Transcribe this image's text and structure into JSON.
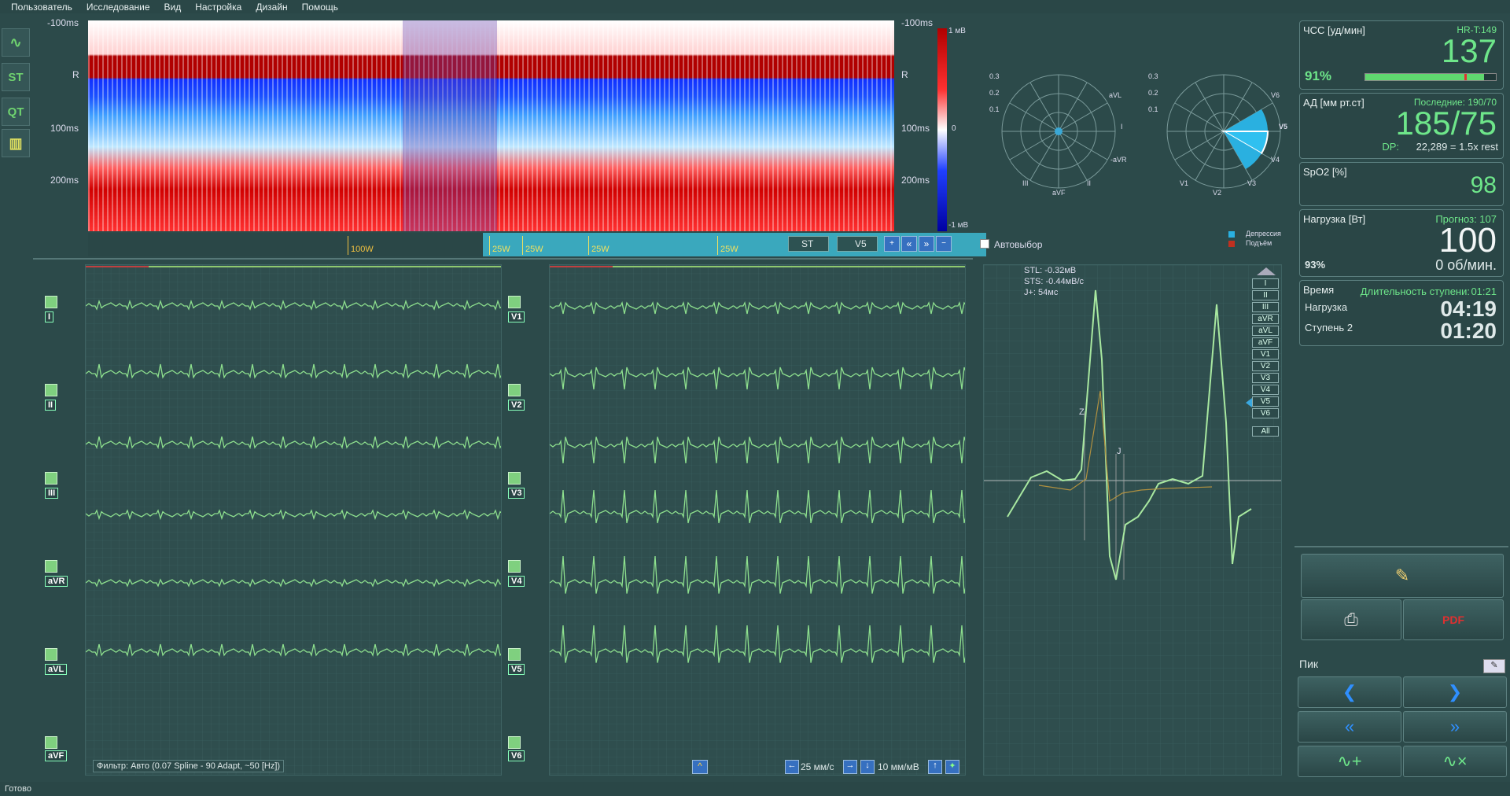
{
  "menu": [
    "Пользователь",
    "Исследование",
    "Вид",
    "Настройка",
    "Дизайн",
    "Помощь"
  ],
  "status": "Готово",
  "trend": {
    "y_ticks_left": [
      "-100ms",
      "R",
      "100ms",
      "200ms"
    ],
    "y_ticks_right": [
      "-100ms",
      "R",
      "100ms",
      "200ms"
    ],
    "colorbar": [
      "1 мВ",
      "0",
      "-1 мВ"
    ],
    "load_markers": [
      "100W",
      "25W",
      "25W",
      "25W",
      "25W"
    ],
    "lead_select": "ST",
    "lead_select2": "V5"
  },
  "polar": {
    "left_ticks": [
      "0.3",
      "0.2",
      "0.1"
    ],
    "left_labels": [
      "aVL",
      "I",
      "-aVR",
      "II",
      "aVF",
      "III"
    ],
    "right_ticks": [
      "0.3",
      "0.2",
      "0.1"
    ],
    "right_labels": [
      "V6",
      "V5",
      "V4",
      "V3",
      "V2",
      "V1"
    ],
    "autoselect": "Автовыбор",
    "legend": [
      "Депрессия",
      "Подъём"
    ]
  },
  "leads_left": [
    "I",
    "II",
    "III",
    "aVR",
    "aVL",
    "aVF"
  ],
  "leads_right": [
    "V1",
    "V2",
    "V3",
    "V4",
    "V5",
    "V6"
  ],
  "filter": "Фильтр: Авто (0.07 Spline - 90 Adapt, ~50 [Hz])",
  "speed": "25 мм/с",
  "gain": "10 мм/мВ",
  "complex": {
    "stl": "STL: -0.32мВ",
    "sts": "STS: -0.44мВ/с",
    "j": "J+: 54мс",
    "z": "Z",
    "jl": "J",
    "lead_buttons": [
      "I",
      "II",
      "III",
      "aVR",
      "aVL",
      "aVF",
      "V1",
      "V2",
      "V3",
      "V4",
      "V5",
      "V6",
      "All"
    ]
  },
  "vitals": {
    "hr_label": "ЧСС [уд/мин]",
    "hr_t": "HR-T:149",
    "hr": "137",
    "hr_pct": "91%",
    "hr_pct_value": 0.91,
    "bp_label": "АД [мм рт.ст]",
    "bp_last": "Последние: 190/70",
    "bp": "185/75",
    "dp_label": "DP:",
    "dp": "22,289 = 1.5x rest",
    "spo2_label": "SpO2 [%]",
    "spo2": "98",
    "load_label": "Нагрузка [Вт]",
    "forecast": "Прогноз: 107",
    "load": "100",
    "load_pct": "93%",
    "rpm": "0 об/мин.",
    "time_label": "Время",
    "stage_dur_label": "Длительность ступени:",
    "stage_dur": "01:21",
    "load_time_label": "Нагрузка",
    "load_time": "04:19",
    "stage_label": "Ступень 2",
    "stage_time": "01:20"
  },
  "peak_label": "Пик"
}
